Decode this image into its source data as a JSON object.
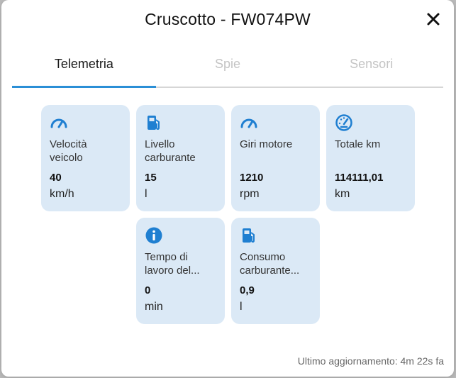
{
  "modal": {
    "title": "Cruscotto - FW074PW",
    "close_icon": "close-icon"
  },
  "tabs": [
    {
      "label": "Telemetria",
      "active": true
    },
    {
      "label": "Spie",
      "active": false
    },
    {
      "label": "Sensori",
      "active": false
    }
  ],
  "cards": [
    {
      "icon": "speedometer-icon",
      "label": "Velocità veicolo",
      "value": "40",
      "unit": "km/h"
    },
    {
      "icon": "fuel-pump-icon",
      "label": "Livello carburante",
      "value": "15",
      "unit": "l"
    },
    {
      "icon": "speedometer-icon",
      "label": "Giri motore",
      "value": "1210",
      "unit": "rpm"
    },
    {
      "icon": "odometer-gauge-icon",
      "label": "Totale km",
      "value": "114111,01",
      "unit": "km"
    },
    {
      "icon": "info-icon",
      "label": "Tempo di lavoro del...",
      "value": "0",
      "unit": "min"
    },
    {
      "icon": "fuel-pump-icon",
      "label": "Consumo carburante...",
      "value": "0,9",
      "unit": "l"
    }
  ],
  "footer": {
    "last_update": "Ultimo aggiornamento: 4m 22s fa"
  },
  "colors": {
    "accent": "#2b8fd6",
    "card_bg": "#dbe9f6",
    "icon": "#1f7fd1"
  }
}
